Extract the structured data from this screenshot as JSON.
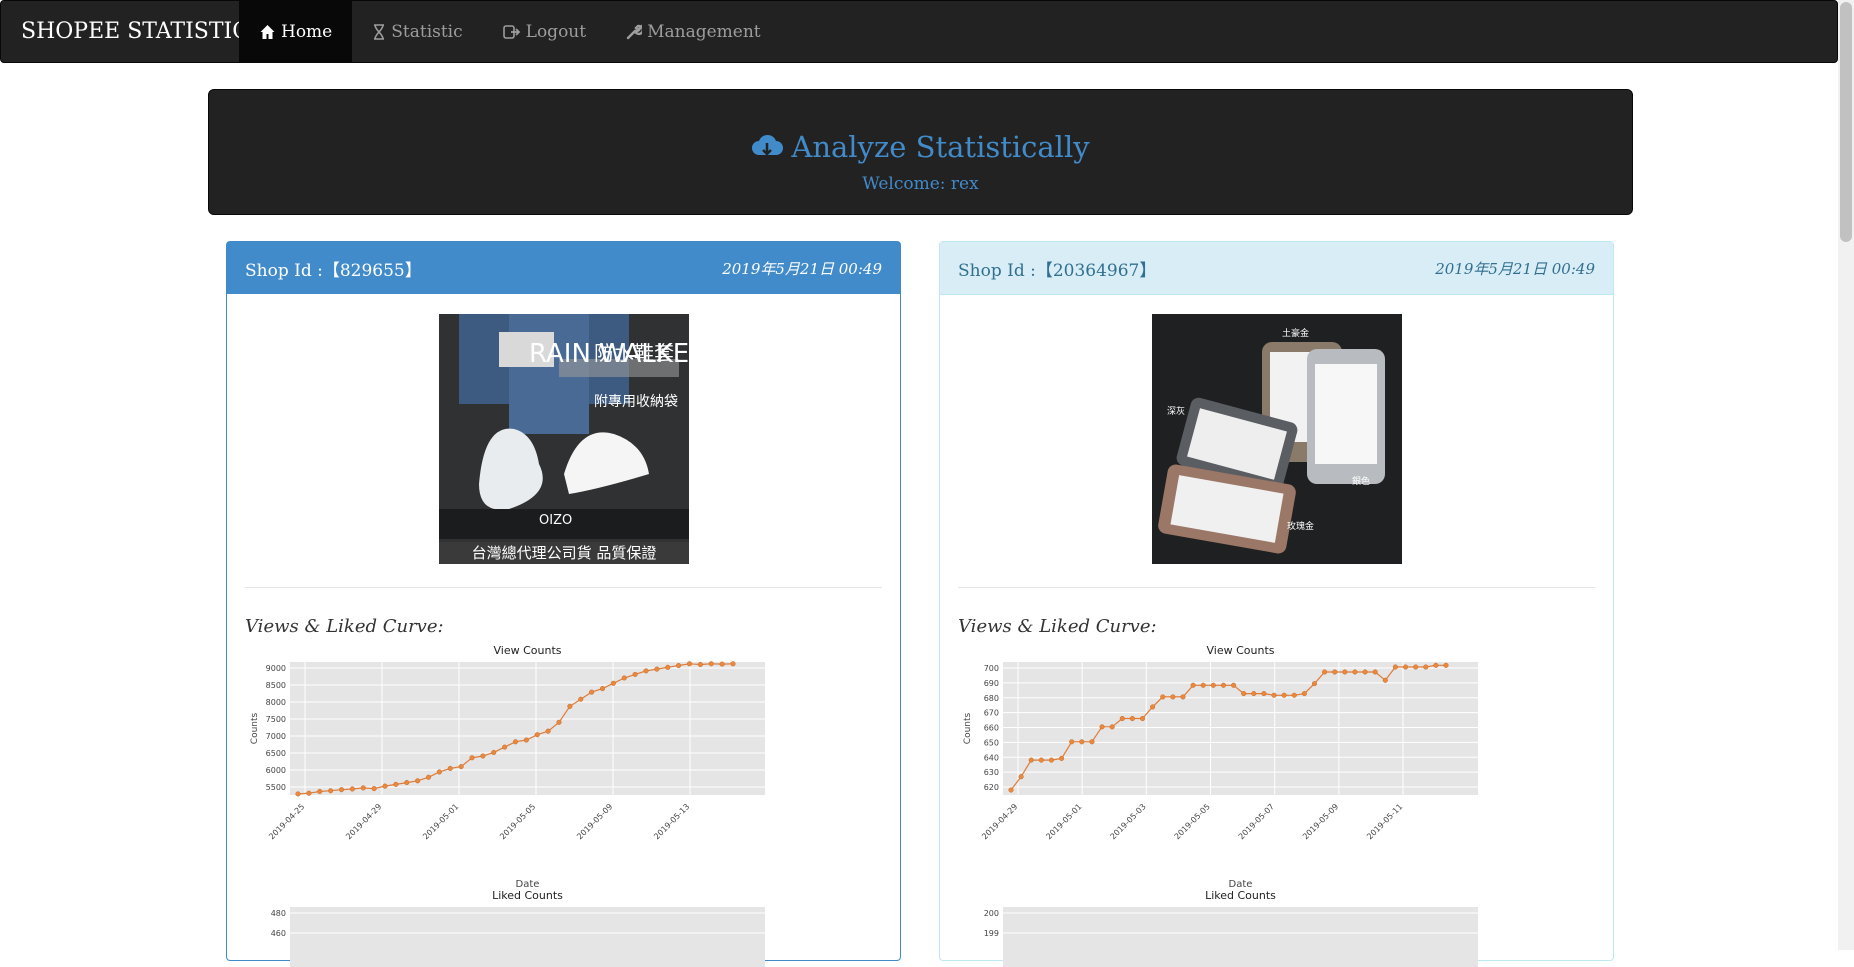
{
  "navbar": {
    "brand": "SHOPEE STATISTIC",
    "items": [
      {
        "label": "Home",
        "icon": "home-icon",
        "active": true
      },
      {
        "label": "Statistic",
        "icon": "hourglass-icon",
        "active": false
      },
      {
        "label": "Logout",
        "icon": "logout-icon",
        "active": false
      },
      {
        "label": "Management",
        "icon": "wrench-icon",
        "active": false
      }
    ]
  },
  "jumbotron": {
    "title": "Analyze Statistically",
    "icon": "cloud-download-icon",
    "welcome": "Welcome: rex",
    "accent_color": "#428bca"
  },
  "shops": [
    {
      "shop_id": "Shop Id :【829655】",
      "date": "2019年5月21日 00:49",
      "image": {
        "title": "RAIN WALKER",
        "subtitle": "防水鞋套",
        "note": "附專用收納袋",
        "brand": "OIZO",
        "footer": "台灣總代理公司貨 品質保證"
      },
      "curve_label": "Views & Liked Curve:",
      "views": {
        "title": "View Counts",
        "xlabel": "Date",
        "ylabel": "Counts",
        "yticks": [
          "9000",
          "8500",
          "8000",
          "7500",
          "7000",
          "6500",
          "6000",
          "5500"
        ],
        "xticks": [
          "2019-04-25",
          "2019-04-29",
          "2019-05-01",
          "2019-05-05",
          "2019-05-09",
          "2019-05-13"
        ]
      },
      "liked": {
        "title": "Liked Counts",
        "yticks": [
          "480",
          "460"
        ]
      }
    },
    {
      "shop_id": "Shop Id :【20364967】",
      "date": "2019年5月21日 00:49",
      "image": {
        "labels": [
          "土豪金",
          "深灰",
          "銀色",
          "玫瑰金"
        ]
      },
      "curve_label": "Views & Liked Curve:",
      "views": {
        "title": "View Counts",
        "xlabel": "Date",
        "ylabel": "Counts",
        "yticks": [
          "700",
          "690",
          "680",
          "670",
          "660",
          "650",
          "640",
          "630",
          "620"
        ],
        "xticks": [
          "2019-04-29",
          "2019-05-01",
          "2019-05-03",
          "2019-05-05",
          "2019-05-07",
          "2019-05-09",
          "2019-05-11"
        ]
      },
      "liked": {
        "title": "Liked Counts",
        "yticks": [
          "200",
          "199"
        ]
      }
    }
  ],
  "chart_data": [
    {
      "type": "line",
      "title": "View Counts",
      "xlabel": "Date",
      "ylabel": "Counts",
      "ylim": [
        5300,
        9050
      ],
      "series": [
        {
          "values": [
            5330,
            5350,
            5400,
            5420,
            5450,
            5470,
            5500,
            5480,
            5550,
            5600,
            5650,
            5700,
            5800,
            5950,
            6050,
            6100,
            6350,
            6400,
            6500,
            6650,
            6800,
            6850,
            7000,
            7100,
            7350,
            7800,
            8000,
            8200,
            8300,
            8450,
            8600,
            8700,
            8800,
            8850,
            8900,
            8950,
            9000,
            8980,
            9000,
            8990,
            9000
          ]
        }
      ]
    },
    {
      "type": "line",
      "title": "View Counts",
      "xlabel": "Date",
      "ylabel": "Counts",
      "ylim": [
        620,
        700
      ],
      "series": [
        {
          "values": [
            623,
            631,
            641,
            641,
            641,
            642,
            652,
            652,
            652,
            661,
            661,
            666,
            666,
            666,
            673,
            679,
            679,
            679,
            686,
            686,
            686,
            686,
            686,
            681,
            681,
            681,
            680,
            680,
            680,
            681,
            687,
            694,
            694,
            694,
            694,
            694,
            694,
            689,
            697,
            697,
            697,
            697,
            698,
            698
          ]
        }
      ]
    }
  ]
}
